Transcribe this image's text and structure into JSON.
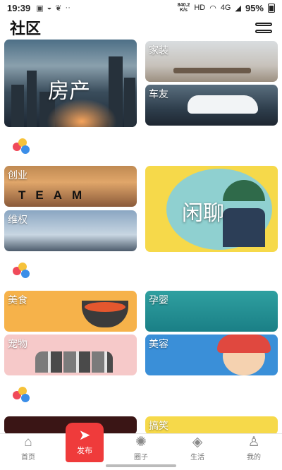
{
  "status_bar": {
    "time": "19:39",
    "speed_value": "840.2",
    "speed_unit": "K/s",
    "hd": "HD",
    "network": "4G",
    "battery": "95%"
  },
  "header": {
    "title": "社区"
  },
  "cards": {
    "house": "房产",
    "home": "家装",
    "car": "车友",
    "startup": "创业",
    "startup_banner": "TEAM",
    "rights": "维权",
    "chat": "闲聊",
    "food": "美食",
    "baby": "孕婴",
    "pet": "宠物",
    "beauty": "美容",
    "fun": "搞笑"
  },
  "colors": {
    "accent_red": "#ef3b3b",
    "dot_red": "#f04a5a",
    "dot_yellow": "#f6c23a",
    "dot_blue": "#3b8ee8"
  },
  "tabbar": {
    "home": "首页",
    "publish": "发布",
    "circle": "圈子",
    "life": "生活",
    "mine": "我的"
  }
}
